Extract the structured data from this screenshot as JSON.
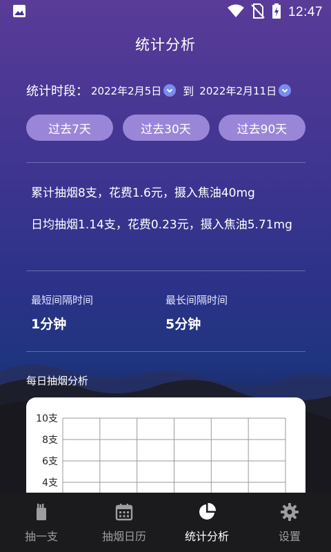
{
  "status": {
    "time": "12:47",
    "icons": [
      "gallery-icon",
      "wifi-icon",
      "no-sim-icon",
      "battery-charging-icon"
    ]
  },
  "header": {
    "title": "统计分析"
  },
  "period": {
    "label": "统计时段：",
    "start_date": "2022年2月5日",
    "to": "到",
    "end_date": "2022年2月11日"
  },
  "range_buttons": [
    {
      "label": "过去7天"
    },
    {
      "label": "过去30天"
    },
    {
      "label": "过去90天"
    }
  ],
  "summary": {
    "total": "累计抽烟8支，花费1.6元，摄入焦油40mg",
    "daily_avg": "日均抽烟1.14支，花费0.23元，摄入焦油5.71mg"
  },
  "intervals": {
    "shortest_label": "最短间隔时间",
    "shortest_value": "1分钟",
    "longest_label": "最长间隔时间",
    "longest_value": "5分钟"
  },
  "chart_section_title": "每日抽烟分析",
  "chart_data": {
    "type": "bar",
    "title": "每日抽烟分析",
    "ylim": [
      0,
      10
    ],
    "y_ticks": [
      "10支",
      "8支",
      "6支",
      "4支"
    ],
    "y_tick_values": [
      10,
      8,
      6,
      4
    ],
    "grid": true,
    "x_columns": 6
  },
  "nav": {
    "items": [
      {
        "label": "抽一支",
        "icon": "cigarette-pack-icon",
        "active": false
      },
      {
        "label": "抽烟日历",
        "icon": "calendar-icon",
        "active": false
      },
      {
        "label": "统计分析",
        "icon": "pie-chart-icon",
        "active": true
      },
      {
        "label": "设置",
        "icon": "gear-icon",
        "active": false
      }
    ]
  },
  "colors": {
    "accent": "#9a86d8",
    "chevron": "#7b8cf0",
    "nav_bg": "#1b1a1d",
    "nav_inactive": "#9e9e9e"
  }
}
